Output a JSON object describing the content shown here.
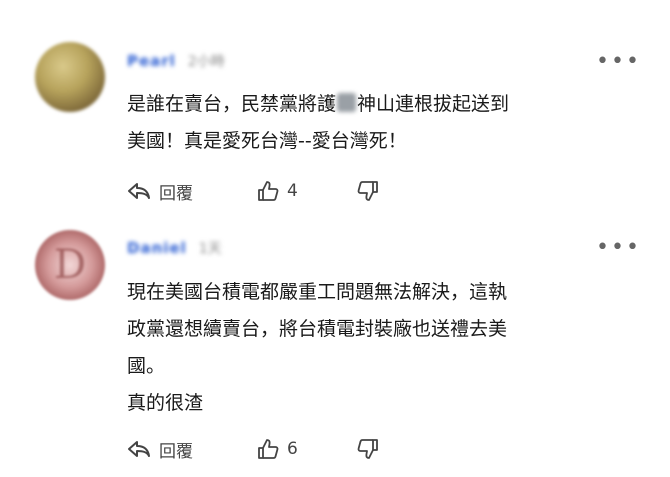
{
  "comments": [
    {
      "author": "Pearl",
      "meta": "2小時",
      "lines": [
        "是誰在賣台，民禁黨將護",
        "神山連根拔起送到",
        "美國！真是愛死台灣--愛台灣死！"
      ],
      "reply_label": "回覆",
      "likes": "4"
    },
    {
      "author": "Daniel",
      "meta": "1天",
      "lines": [
        "現在美國台積電都嚴重工問題無法解決，這執",
        "政黨還想續賣台，將台積電封裝廠也送禮去美",
        "國。",
        "真的很渣"
      ],
      "reply_label": "回覆",
      "likes": "6"
    }
  ],
  "icons": {
    "more": "more-options-icon",
    "reply": "reply-arrow-icon",
    "like": "thumbs-up-icon",
    "dislike": "thumbs-down-icon"
  },
  "colors": {
    "author_name": "#2d5fd3",
    "text": "#1a1a1a",
    "icon": "#444444"
  }
}
